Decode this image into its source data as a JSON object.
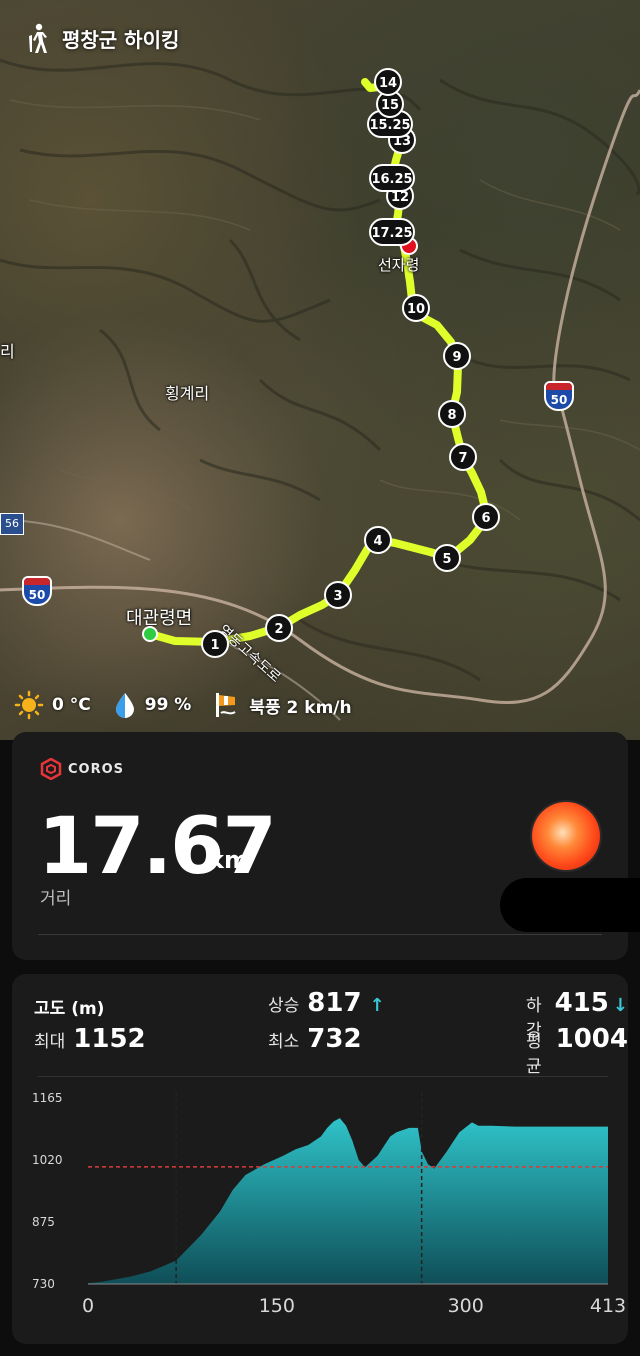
{
  "header": {
    "title": "평창군 하이킹",
    "icon": "hiker-icon"
  },
  "map": {
    "labels": {
      "hoenggyeri": "횡계리",
      "daegwallyeong": "대관령면",
      "expressway": "영동고속도로",
      "seongaryeong": "선자령",
      "left_edge": "리"
    },
    "route_badges": {
      "interstate_50": "50",
      "route_56": "56"
    },
    "route_color": "#dfff2a",
    "markers": [
      "1",
      "2",
      "3",
      "4",
      "5",
      "6",
      "7",
      "8",
      "9",
      "10",
      "17.25",
      "12",
      "16.25",
      "13",
      "15.25",
      "15",
      "14"
    ]
  },
  "weather": {
    "temperature": "0 °C",
    "humidity": "99 %",
    "wind": "북풍 2 km/h"
  },
  "coros": {
    "logo_text": "COROS",
    "distance_value": "17.67",
    "distance_unit": "km",
    "distance_label": "거리"
  },
  "elevation": {
    "title": "고도 (m)",
    "ascent_label": "상승",
    "ascent_value": "817",
    "descent_label": "하강",
    "descent_value": "415",
    "max_label": "최대",
    "max_value": "1152",
    "min_label": "최소",
    "min_value": "732",
    "avg_label": "평균",
    "avg_value": "1004"
  },
  "chart_data": {
    "type": "area",
    "title": "",
    "xlabel": "",
    "ylabel": "",
    "x_ticks": [
      "0",
      "150",
      "300",
      "413"
    ],
    "y_ticks": [
      "1165",
      "1020",
      "875",
      "730"
    ],
    "xlim": [
      0,
      413
    ],
    "ylim": [
      730,
      1165
    ],
    "reference_line": {
      "value": 1004,
      "style": "dashed",
      "color": "#d93b3b"
    },
    "vertical_markers": [
      70,
      265
    ],
    "fill_color": "#2fc3c9",
    "x": [
      0,
      10,
      20,
      35,
      50,
      60,
      70,
      75,
      90,
      105,
      115,
      125,
      140,
      155,
      165,
      175,
      185,
      190,
      195,
      200,
      205,
      210,
      215,
      220,
      230,
      240,
      245,
      255,
      262,
      265,
      270,
      275,
      285,
      295,
      305,
      310,
      320,
      340,
      360,
      380,
      400,
      413
    ],
    "y": [
      732,
      735,
      740,
      748,
      760,
      772,
      785,
      800,
      845,
      900,
      950,
      985,
      1010,
      1030,
      1045,
      1055,
      1075,
      1095,
      1110,
      1118,
      1100,
      1065,
      1020,
      1003,
      1030,
      1075,
      1085,
      1095,
      1095,
      1040,
      1010,
      1000,
      1040,
      1085,
      1108,
      1100,
      1100,
      1098,
      1098,
      1098,
      1098,
      1098
    ]
  }
}
